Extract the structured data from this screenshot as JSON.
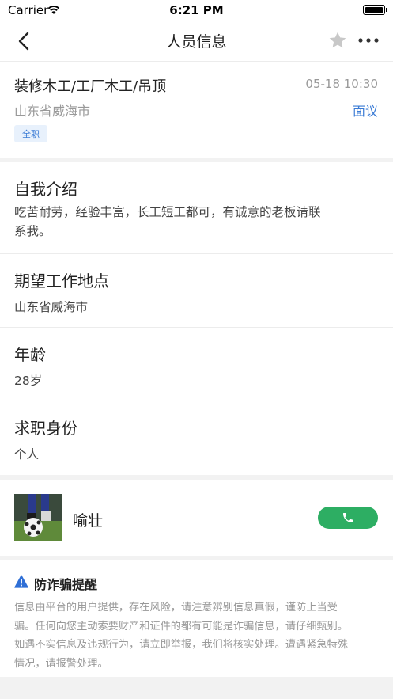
{
  "status_bar": {
    "carrier": "Carrier",
    "time": "6:21 PM"
  },
  "nav": {
    "title": "人员信息",
    "icons": [
      "back-arrow-icon",
      "star-icon",
      "more-icon"
    ]
  },
  "job": {
    "title": "装修木工/工厂木工/吊顶",
    "time": "05-18 10:30",
    "location": "山东省威海市",
    "interview_label": "面议",
    "type_badge": "全职"
  },
  "sections": [
    {
      "title": "自我介绍",
      "body_line1": "吃苦耐劳，经验丰富，长工短工都可，有诚意的老板请联",
      "body_line2": "系我。"
    },
    {
      "title": "期望工作地点",
      "body": "山东省威海市"
    },
    {
      "title": "年龄",
      "body": "28岁"
    },
    {
      "title": "求职身份",
      "body": "个人"
    }
  ],
  "contact": {
    "name": "喻壮",
    "call_icon": "phone-icon"
  },
  "warning": {
    "title": "防诈骗提醒",
    "lines": [
      "信息由平台的用户提供，存在风险，请注意辨别信息真假，谨防上当受",
      "骗。任何向您主动索要财产和证件的都有可能是诈骗信息，请仔细甄别。",
      "如遇不实信息及违规行为，请立即举报，我们将核实处理。遭遇紧急特殊",
      "情况，请报警处理。"
    ]
  },
  "colors": {
    "accent_blue": "#3a7bd5",
    "call_green": "#2dae63",
    "warning_blue": "#2f6fd6"
  }
}
